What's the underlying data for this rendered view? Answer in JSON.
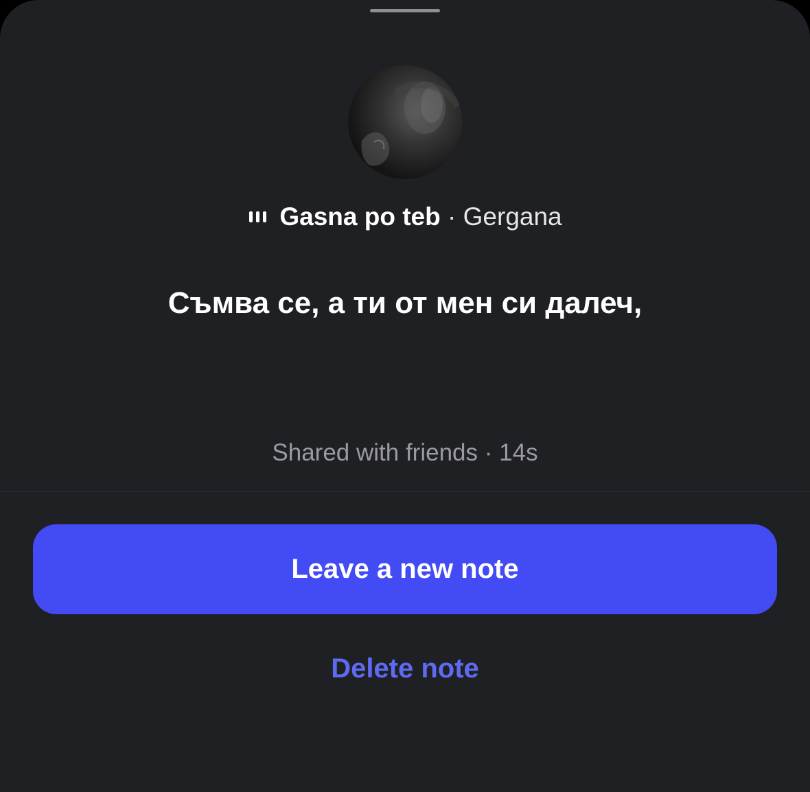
{
  "note": {
    "song_title": "Gasna po teb",
    "separator": "·",
    "artist": "Gergana",
    "lyric": "Съмва се, а ти от мен си далеч,",
    "audience": "Shared with friends",
    "age": "14s"
  },
  "actions": {
    "primary_label": "Leave a new note",
    "delete_label": "Delete note"
  },
  "icons": {
    "music_bars": "audio-bars-icon"
  },
  "colors": {
    "sheet_background": "#1f2024",
    "primary_button": "#434bf5",
    "delete_text": "#5e6af2",
    "meta_text": "#9a9aa0"
  }
}
